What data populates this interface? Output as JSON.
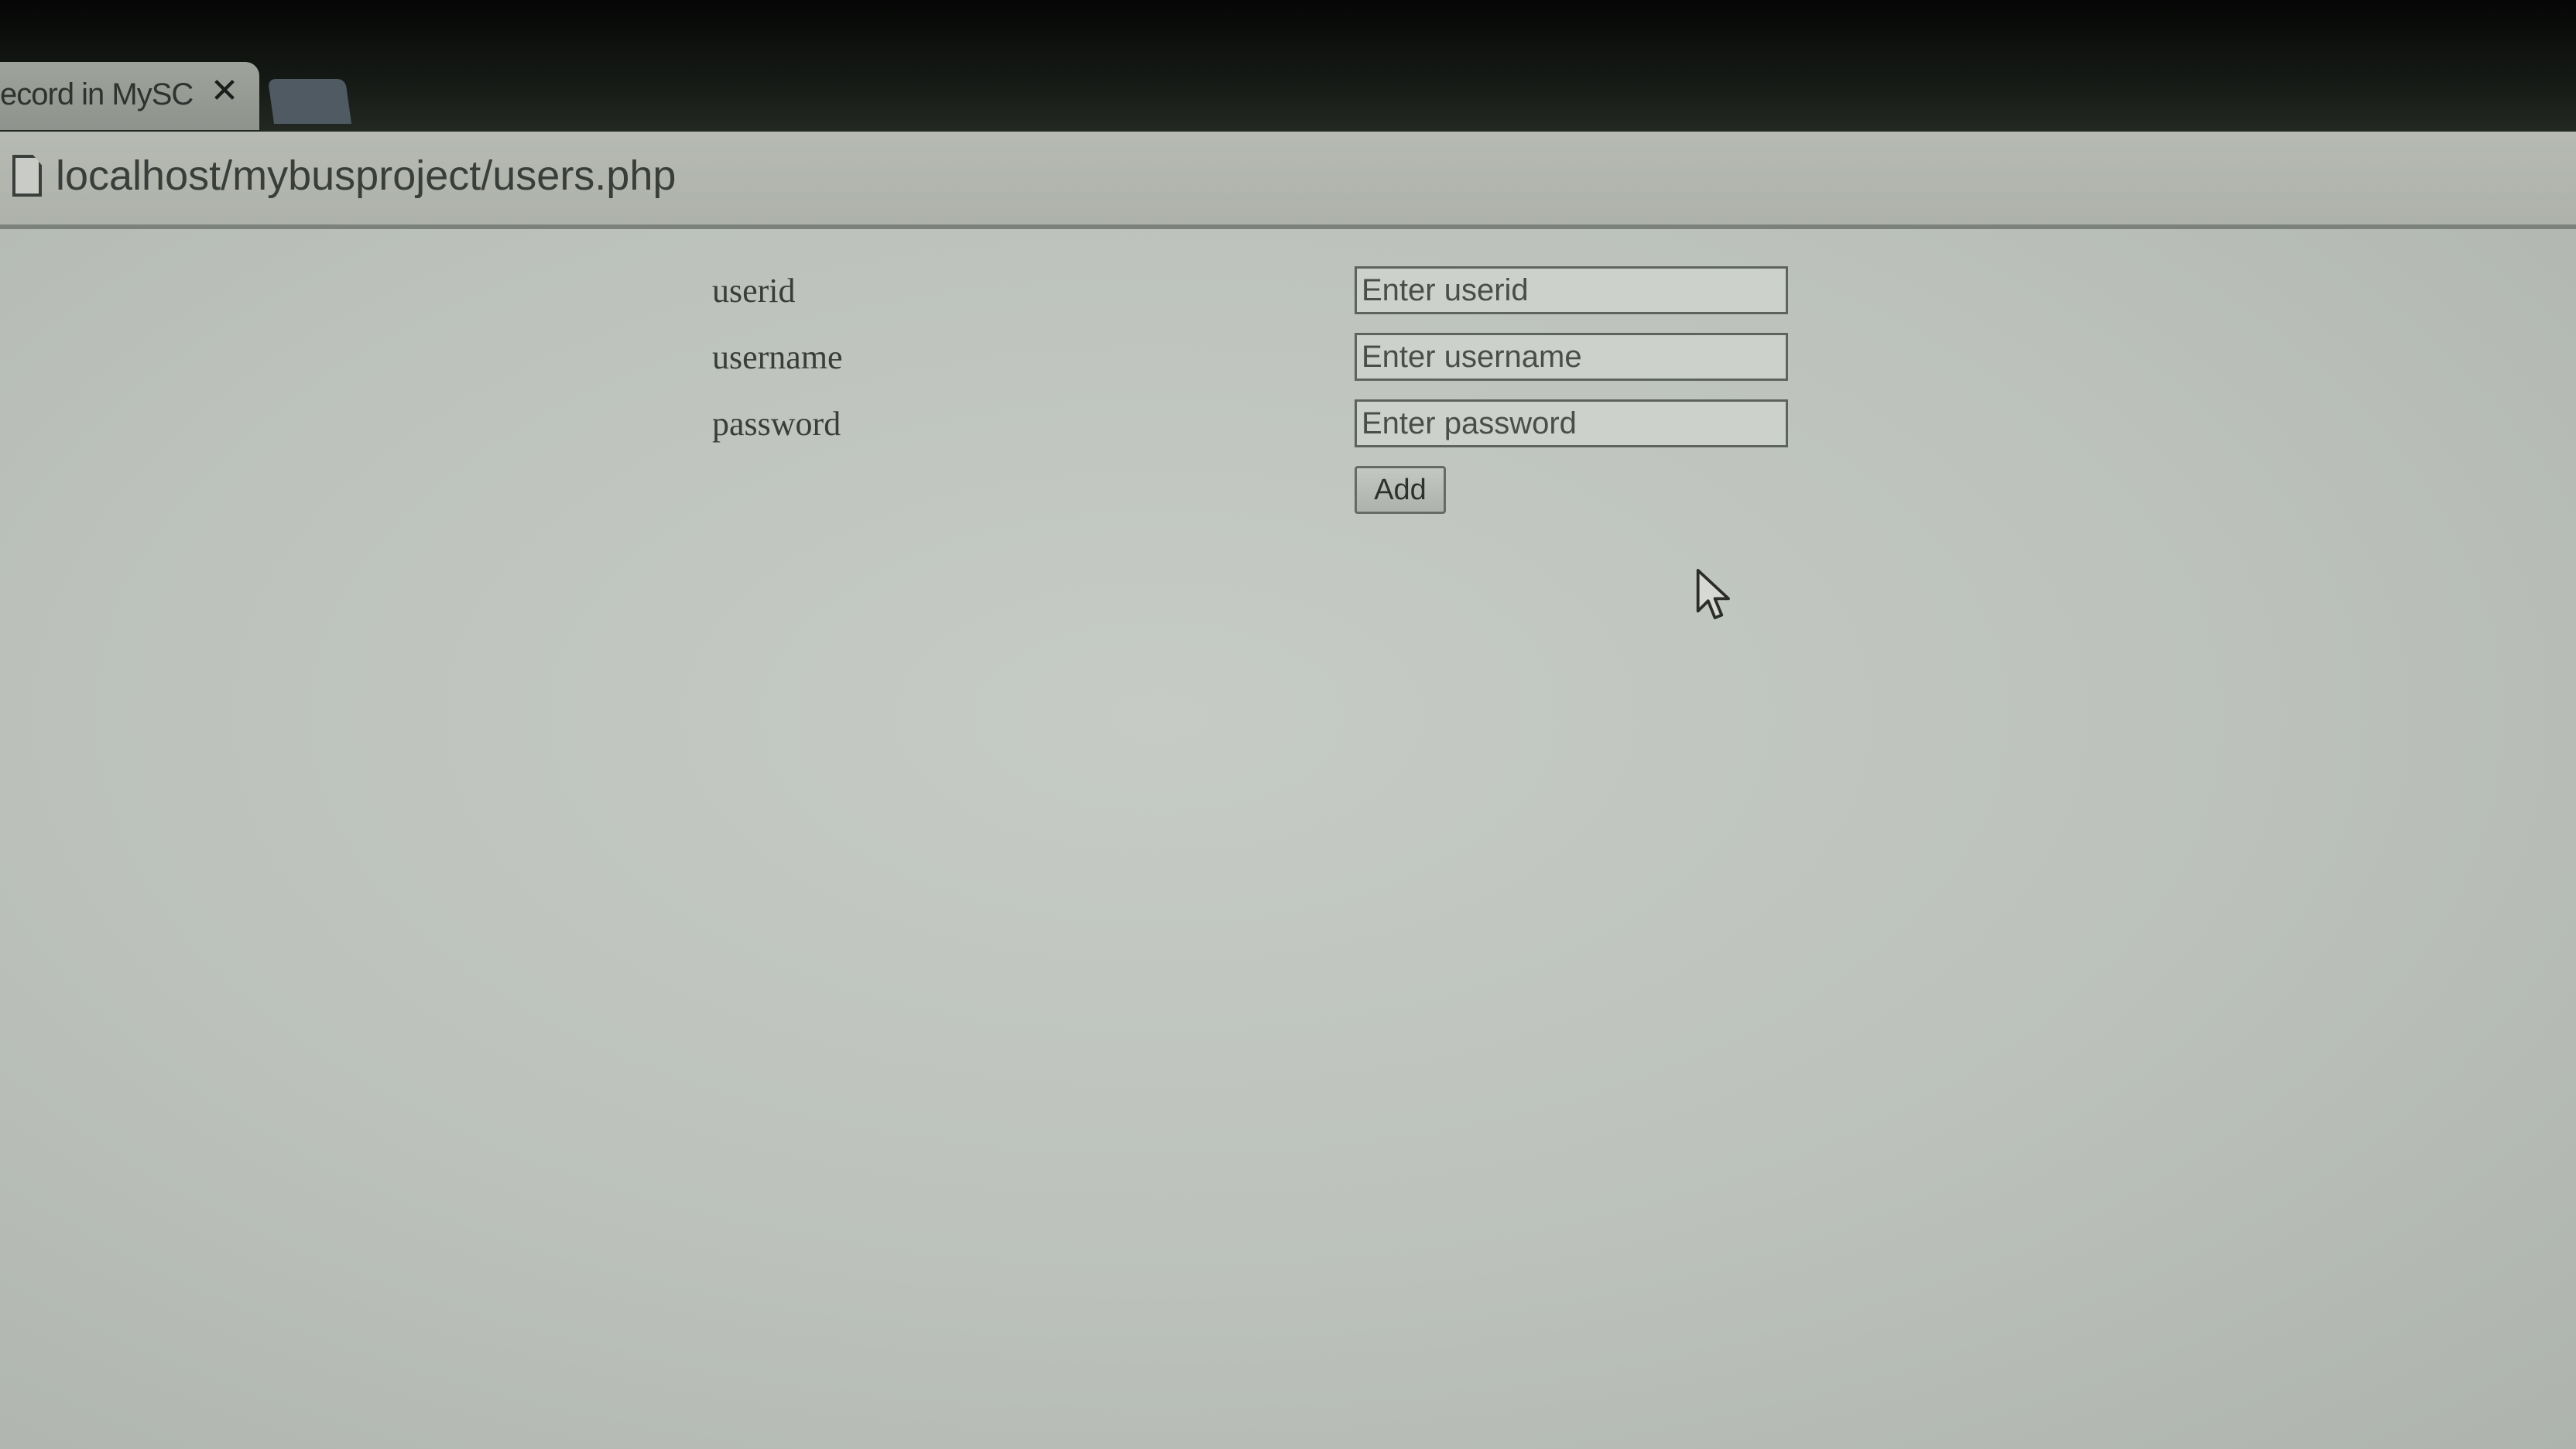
{
  "browser": {
    "tab_title": "ecord in MySC",
    "tab_close_glyph": "✕",
    "url": "localhost/mybusproject/users.php"
  },
  "form": {
    "fields": [
      {
        "label": "userid",
        "placeholder": "Enter userid"
      },
      {
        "label": "username",
        "placeholder": "Enter username"
      },
      {
        "label": "password",
        "placeholder": "Enter password"
      }
    ],
    "submit_label": "Add"
  },
  "icons": {
    "page": "page-icon",
    "close": "close-icon",
    "cursor": "mouse-cursor-icon"
  }
}
